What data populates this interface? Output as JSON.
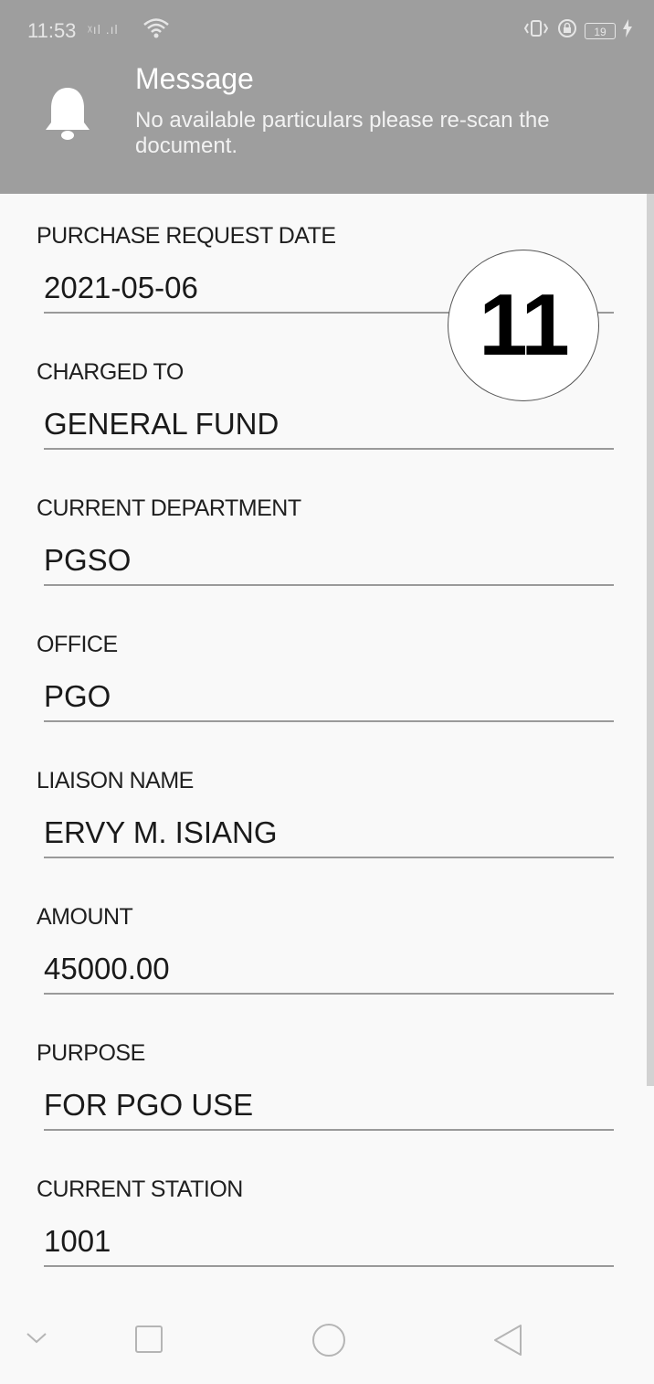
{
  "status_bar": {
    "time": "11:53",
    "battery_level": "19",
    "signal_text": "ᵡıl .ıl"
  },
  "notification": {
    "icon": "bell-icon",
    "title": "Message",
    "body": "No available particulars please re-scan the document."
  },
  "form": {
    "fields": [
      {
        "label": "PURCHASE REQUEST DATE",
        "value": "2021-05-06"
      },
      {
        "label": "CHARGED TO",
        "value": "GENERAL FUND"
      },
      {
        "label": "CURRENT DEPARTMENT",
        "value": "PGSO"
      },
      {
        "label": "OFFICE",
        "value": "PGO"
      },
      {
        "label": "LIAISON NAME",
        "value": "ERVY M. ISIANG"
      },
      {
        "label": "AMOUNT",
        "value": "45000.00"
      },
      {
        "label": "PURPOSE",
        "value": "FOR PGO USE"
      },
      {
        "label": "CURRENT STATION",
        "value": "1001"
      }
    ]
  },
  "annotation_badge": "11",
  "navigation": {
    "buttons": [
      "chevron-down-icon",
      "recents-icon",
      "home-icon",
      "back-icon"
    ]
  },
  "colors": {
    "notification_bg": "#9e9e9e",
    "page_bg": "#f9f9f9",
    "underline": "#9a9a9a"
  }
}
